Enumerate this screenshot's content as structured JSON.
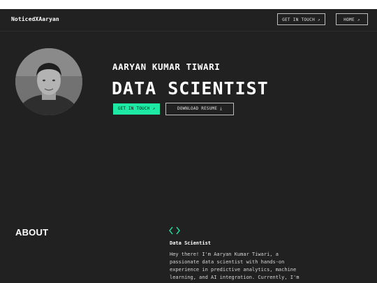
{
  "nav": {
    "brand": "NoticedXAaryan",
    "contact_label": "GET IN TOUCH",
    "home_label": "HOME",
    "arrow": "↗"
  },
  "hero": {
    "name": "AARYAN KUMAR TIWARI",
    "title": "DATA SCIENTIST",
    "primary_cta": "GET IN TOUCH",
    "secondary_cta": "DOWNLOAD RESUME",
    "arrow": "↗",
    "download_glyph": "⤓",
    "avatar_icon": "profile-photo"
  },
  "about": {
    "heading": "ABOUT",
    "subheading": "Data Scientist",
    "body": "Hey there! I'm Aaryan Kumar Tiwari, a passionate data scientist with hands-on experience in predictive analytics, machine learning, and AI integration. Currently, I'm",
    "icon": "code-icon"
  },
  "colors": {
    "background": "#212121",
    "accent": "#1de9a5",
    "text": "#ffffff"
  }
}
